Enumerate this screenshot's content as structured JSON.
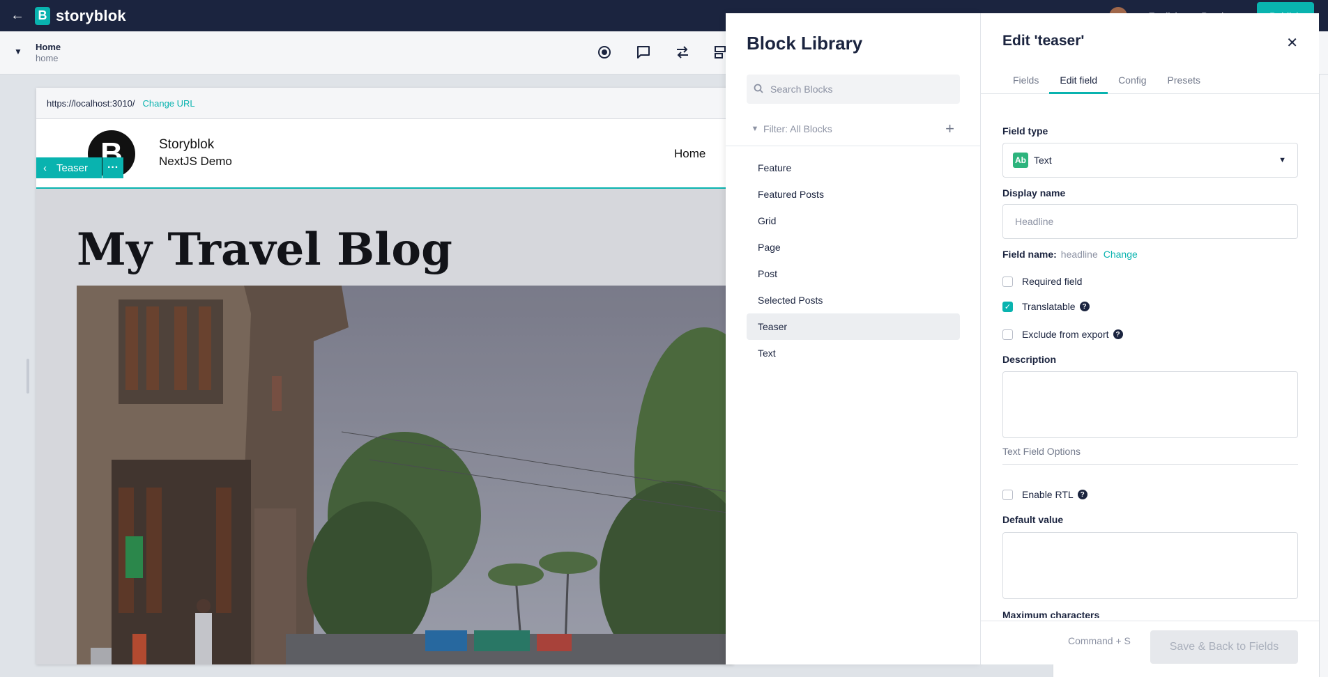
{
  "topbar": {
    "brand": "storyblok",
    "logo_letter": "B",
    "language": "English",
    "mode": "Preview",
    "publish_label": "Publish"
  },
  "story": {
    "title": "Home",
    "slug": "home"
  },
  "preview": {
    "url": "https://localhost:3010/",
    "change_url_label": "Change URL",
    "site_name": "Storyblok",
    "site_sub": "NextJS Demo",
    "nav_home": "Home",
    "teaser_label": "Teaser",
    "teaser_more": "···",
    "blog_title": "My Travel Blog",
    "logo_letter": "B"
  },
  "block_library": {
    "title": "Block Library",
    "search_placeholder": "Search Blocks",
    "filter_label": "Filter: All Blocks",
    "items": [
      {
        "label": "Feature"
      },
      {
        "label": "Featured Posts"
      },
      {
        "label": "Grid"
      },
      {
        "label": "Page"
      },
      {
        "label": "Post"
      },
      {
        "label": "Selected Posts"
      },
      {
        "label": "Teaser",
        "active": true
      },
      {
        "label": "Text"
      }
    ]
  },
  "edit_panel": {
    "title": "Edit 'teaser'",
    "tabs": [
      {
        "label": "Fields"
      },
      {
        "label": "Edit field",
        "active": true
      },
      {
        "label": "Config"
      },
      {
        "label": "Presets"
      }
    ],
    "field_type_label": "Field type",
    "field_type_badge": "Ab",
    "field_type_value": "Text",
    "display_name_label": "Display name",
    "display_name_placeholder": "Headline",
    "field_name_label": "Field name:",
    "field_name_value": "headline",
    "field_name_change": "Change",
    "required_label": "Required field",
    "required_checked": false,
    "translatable_label": "Translatable",
    "translatable_checked": true,
    "exclude_label": "Exclude from export",
    "exclude_checked": false,
    "description_label": "Description",
    "text_field_options_label": "Text Field Options",
    "enable_rtl_label": "Enable RTL",
    "enable_rtl_checked": false,
    "default_value_label": "Default value",
    "max_chars_label": "Maximum characters",
    "shortcut_label": "Command + S",
    "save_label": "Save & Back to Fields"
  },
  "colors": {
    "accent": "#09b3af",
    "topbar_bg": "#1b243f",
    "text_badge": "#2db47d"
  }
}
